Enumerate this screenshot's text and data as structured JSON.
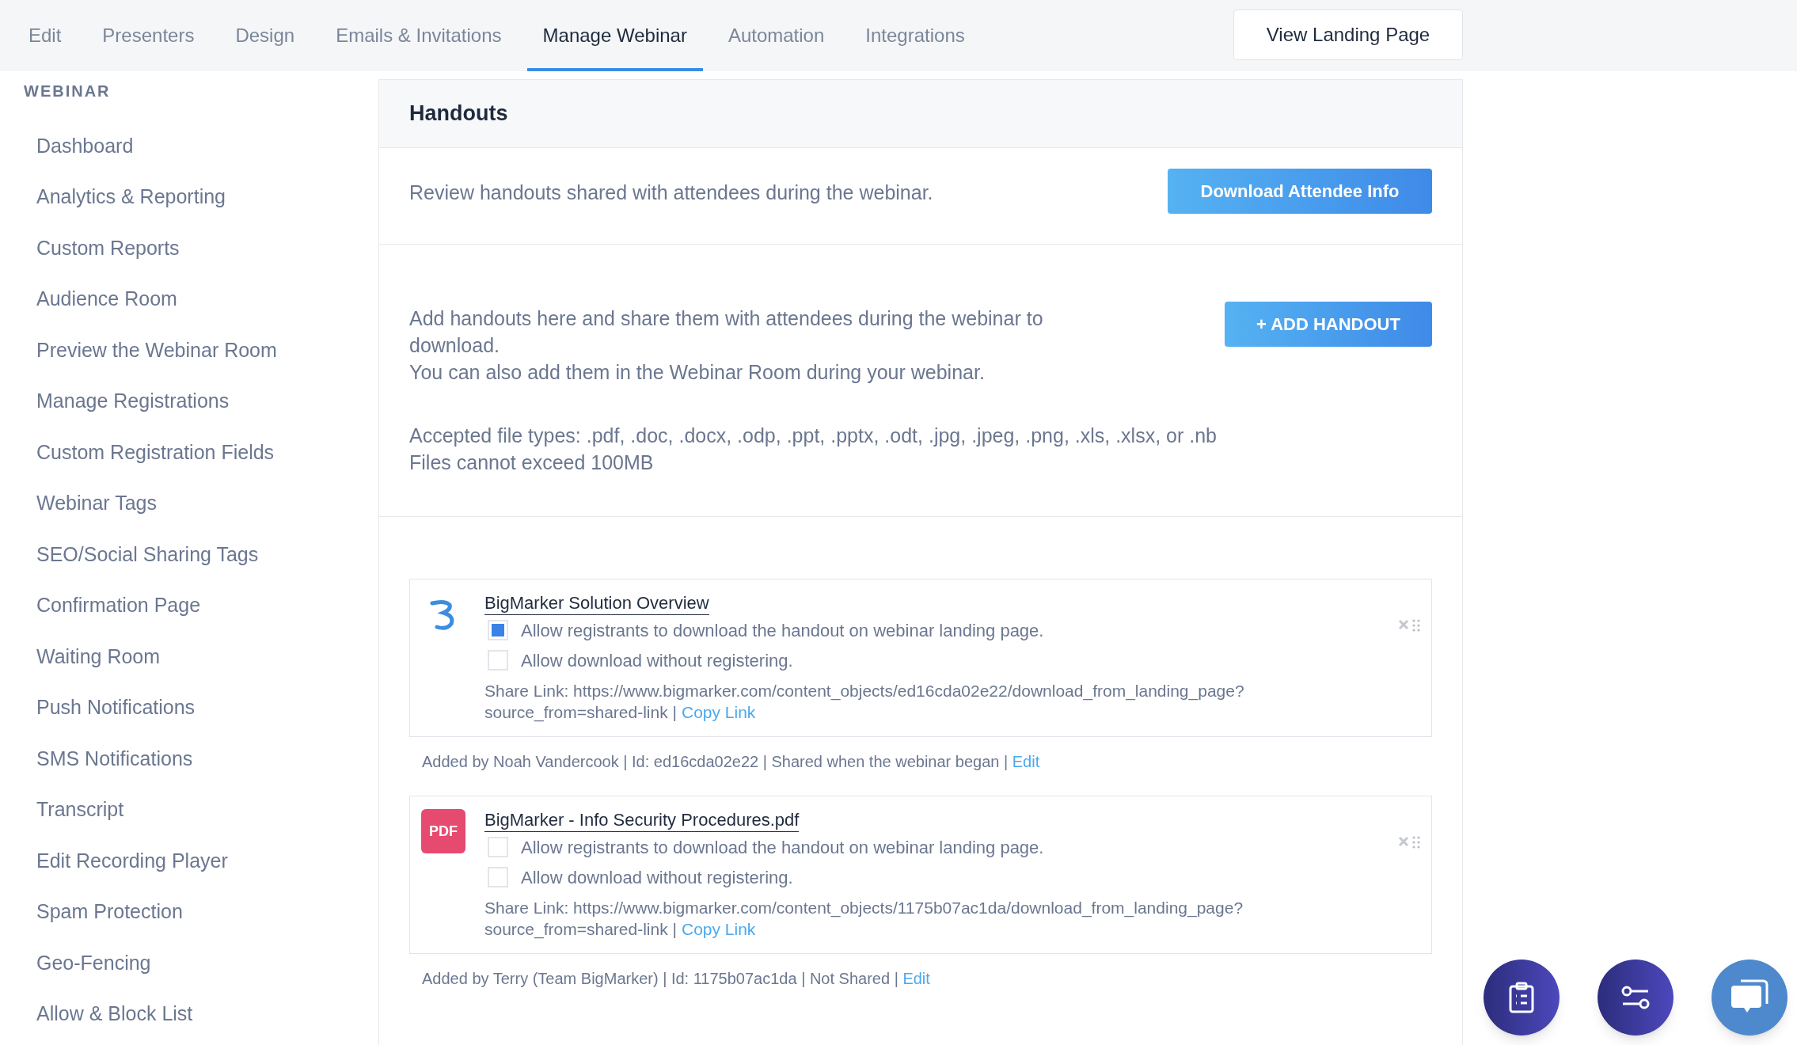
{
  "tabs": [
    {
      "label": "Edit",
      "selected": false
    },
    {
      "label": "Presenters",
      "selected": false
    },
    {
      "label": "Design",
      "selected": false
    },
    {
      "label": "Emails & Invitations",
      "selected": false
    },
    {
      "label": "Manage Webinar",
      "selected": true
    },
    {
      "label": "Automation",
      "selected": false
    },
    {
      "label": "Integrations",
      "selected": false
    }
  ],
  "view_landing_page_button": "View Landing Page",
  "sidebar": {
    "heading": "WEBINAR",
    "items": [
      "Dashboard",
      "Analytics & Reporting",
      "Custom Reports",
      "Audience Room",
      "Preview the Webinar Room",
      "Manage Registrations",
      "Custom Registration Fields",
      "Webinar Tags",
      "SEO/Social Sharing Tags",
      "Confirmation Page",
      "Waiting Room",
      "Push Notifications",
      "SMS Notifications",
      "Transcript",
      "Edit Recording Player",
      "Spam Protection",
      "Geo-Fencing",
      "Allow & Block List"
    ]
  },
  "panel": {
    "title": "Handouts",
    "review_text": "Review handouts shared with attendees during the webinar.",
    "download_button": "Download Attendee Info",
    "add_text_lines": [
      "Add handouts here and share them with attendees during the webinar to download.",
      "You can also add them in the Webinar Room during your webinar."
    ],
    "add_button": "+ ADD HANDOUT",
    "accepted_lines": [
      "Accepted file types: .pdf, .doc, .docx, .odp, .ppt, .pptx, .odt, .jpg, .jpeg, .png, .xls, .xlsx, or .nb",
      "Files cannot exceed 100MB"
    ]
  },
  "handouts": [
    {
      "kind": "logo",
      "title": "BigMarker Solution Overview",
      "options": [
        {
          "label": "Allow registrants to download the handout on webinar landing page.",
          "checked": true
        },
        {
          "label": "Allow download without registering.",
          "checked": false
        }
      ],
      "share_link": [
        "Share Link: https://www.bigmarker.com/content_objects/ed16cda02e22/download_from_landing_page?",
        "source_from=shared-link |"
      ],
      "copy_link": "Copy Link",
      "footer": "Added by Noah Vandercook | Id: ed16cda02e22 | Shared when the webinar began |",
      "edit_link": "Edit"
    },
    {
      "kind": "pdf",
      "badge": "PDF",
      "title": "BigMarker - Info Security Procedures.pdf",
      "options": [
        {
          "label": "Allow registrants to download the handout on webinar landing page.",
          "checked": false
        },
        {
          "label": "Allow download without registering.",
          "checked": false
        }
      ],
      "share_link": [
        "Share Link: https://www.bigmarker.com/content_objects/1175b07ac1da/download_from_landing_page?",
        "source_from=shared-link |"
      ],
      "copy_link": "Copy Link",
      "footer": "Added by Terry (Team BigMarker) | Id: 1175b07ac1da | Not Shared |",
      "edit_link": "Edit"
    }
  ]
}
